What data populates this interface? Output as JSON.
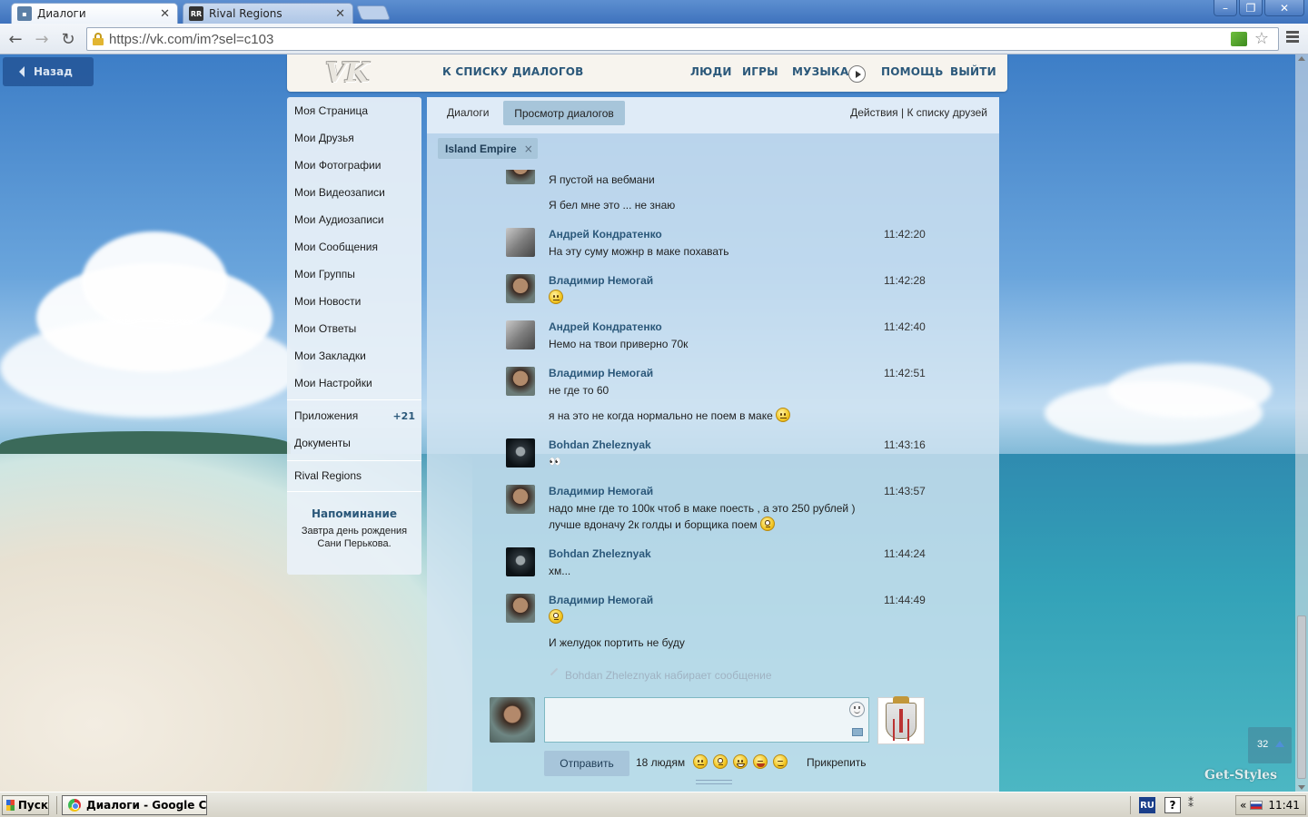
{
  "browser": {
    "tabs": [
      {
        "label": "Диалоги",
        "favicon": "vk",
        "active": true
      },
      {
        "label": "Rival Regions",
        "favicon": "RR",
        "active": false
      }
    ],
    "url": "https://vk.com/im?sel=c103"
  },
  "back_button": {
    "label": "Назад"
  },
  "header": {
    "logo": "VK",
    "to_dialogs": "К СПИСКУ ДИАЛОГОВ",
    "nav": [
      "ЛЮДИ",
      "ИГРЫ",
      "МУЗЫКА",
      "ПОМОЩЬ",
      "ВЫЙТИ"
    ]
  },
  "left_menu": {
    "items": [
      "Моя Страница",
      "Мои Друзья",
      "Мои Фотографии",
      "Мои Видеозаписи",
      "Мои Аудиозаписи",
      "Мои Сообщения",
      "Мои Группы",
      "Мои Новости",
      "Мои Ответы",
      "Мои Закладки",
      "Мои Настройки"
    ],
    "apps_label": "Приложения",
    "apps_count": "+21",
    "docs_label": "Документы",
    "rival_label": "Rival Regions",
    "reminder": {
      "title": "Напоминание",
      "line1": "Завтра день рождения",
      "line2": "Сани Перькова."
    }
  },
  "dialog": {
    "tab_dialogs": "Диалоги",
    "tab_view": "Просмотр диалогов",
    "actions": "Действия",
    "separator": "|",
    "friends_list": "К списку друзей",
    "chat_chip": "Island Empire",
    "chip_close": "×",
    "messages": {
      "m0": {
        "line1": "Я пустой на вебмани",
        "line2": "Я бел мне это ... не знаю"
      },
      "m1": {
        "sender": "Андрей Кондратенко",
        "time": "11:42:20",
        "text": "На эту суму можнр в маке похавать"
      },
      "m2": {
        "sender": "Владимир Немогай",
        "time": "11:42:28"
      },
      "m3": {
        "sender": "Андрей Кондратенко",
        "time": "11:42:40",
        "text": "Немо на твои приверно 70к"
      },
      "m4": {
        "sender": "Владимир Немогай",
        "time": "11:42:51",
        "text": "не где то 60",
        "text2": "я на это не когда нормально не поем в маке"
      },
      "m5": {
        "sender": "Bohdan Zheleznyak",
        "time": "11:43:16",
        "text": "👀"
      },
      "m6": {
        "sender": "Владимир Немогай",
        "time": "11:43:57",
        "text": "надо мне где то 100к чтоб в маке поесть , а это 250 рублей )",
        "text2": "лучше вдоначу 2к голды и борщика поем"
      },
      "m7": {
        "sender": "Bohdan Zheleznyak",
        "time": "11:44:24",
        "text": "хм..."
      },
      "m8": {
        "sender": "Владимир Немогай",
        "time": "11:44:49",
        "text2": "И желудок портить не буду"
      }
    },
    "typing": "Bohdan Zheleznyak набирает сообщение",
    "composer": {
      "send_label": "Отправить",
      "people": "18 людям",
      "attach": "Прикрепить"
    }
  },
  "counter": "32",
  "watermark": "Get-Styles",
  "taskbar": {
    "start": "Пуск",
    "window": "Диалоги - Google C...",
    "lang": "RU",
    "chevron": "«",
    "clock": "11:41"
  }
}
